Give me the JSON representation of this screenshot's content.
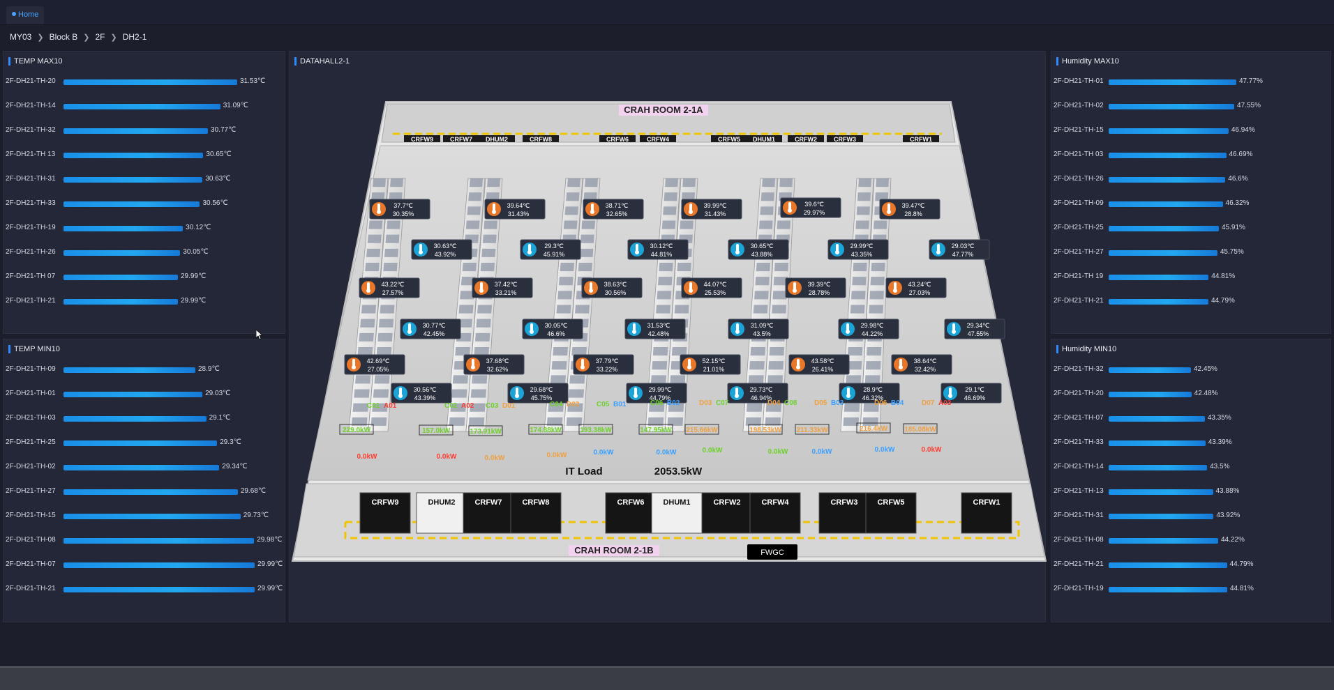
{
  "tab": {
    "label": "Home"
  },
  "breadcrumb": [
    "MY03",
    "Block B",
    "2F",
    "DH2-1"
  ],
  "colors": {
    "accent": "#2f8cff",
    "bar": "#22a7f0",
    "background": "#1c1f2b",
    "panel": "#232737"
  },
  "panels": {
    "temp_max": {
      "title": "TEMP MAX10",
      "rows": [
        {
          "label": "2F-DH21-TH-20",
          "value": "31.53℃",
          "num": 31.53
        },
        {
          "label": "2F-DH21-TH-14",
          "value": "31.09℃",
          "num": 31.09
        },
        {
          "label": "2F-DH21-TH-32",
          "value": "30.77℃",
          "num": 30.77
        },
        {
          "label": "2F-DH21-TH 13",
          "value": "30.65℃",
          "num": 30.65
        },
        {
          "label": "2F-DH21-TH-31",
          "value": "30.63℃",
          "num": 30.63
        },
        {
          "label": "2F-DH21-TH-33",
          "value": "30.56℃",
          "num": 30.56
        },
        {
          "label": "2F-DH21-TH-19",
          "value": "30.12℃",
          "num": 30.12
        },
        {
          "label": "2F-DH21-TH-26",
          "value": "30.05℃",
          "num": 30.05
        },
        {
          "label": "2F-DH21-TH 07",
          "value": "29.99℃",
          "num": 29.99
        },
        {
          "label": "2F-DH21-TH-21",
          "value": "29.99℃",
          "num": 29.99
        }
      ]
    },
    "temp_min": {
      "title": "TEMP MIN10",
      "rows": [
        {
          "label": "2F-DH21-TH-09",
          "value": "28.9℃",
          "num": 28.9
        },
        {
          "label": "2F-DH21-TH-01",
          "value": "29.03℃",
          "num": 29.03
        },
        {
          "label": "2F-DH21-TH-03",
          "value": "29.1℃",
          "num": 29.1
        },
        {
          "label": "2F-DH21-TH-25",
          "value": "29.3℃",
          "num": 29.3
        },
        {
          "label": "2F-DH21-TH-02",
          "value": "29.34℃",
          "num": 29.34
        },
        {
          "label": "2F-DH21-TH-27",
          "value": "29.68℃",
          "num": 29.68
        },
        {
          "label": "2F-DH21-TH-15",
          "value": "29.73℃",
          "num": 29.73
        },
        {
          "label": "2F-DH21-TH-08",
          "value": "29.98℃",
          "num": 29.98
        },
        {
          "label": "2F-DH21-TH-07",
          "value": "29.99℃",
          "num": 29.99
        },
        {
          "label": "2F-DH21-TH-21",
          "value": "29.99℃",
          "num": 29.99
        }
      ]
    },
    "hum_max": {
      "title": "Humidity MAX10",
      "rows": [
        {
          "label": "2F-DH21-TH-01",
          "value": "47.77%",
          "num": 47.77
        },
        {
          "label": "2F-DH21-TH-02",
          "value": "47.55%",
          "num": 47.55
        },
        {
          "label": "2F-DH21-TH-15",
          "value": "46.94%",
          "num": 46.94
        },
        {
          "label": "2F-DH21-TH 03",
          "value": "46.69%",
          "num": 46.69
        },
        {
          "label": "2F-DH21-TH-26",
          "value": "46.6%",
          "num": 46.6
        },
        {
          "label": "2F-DH21-TH-09",
          "value": "46.32%",
          "num": 46.32
        },
        {
          "label": "2F-DH21-TH-25",
          "value": "45.91%",
          "num": 45.91
        },
        {
          "label": "2F-DH21-TH-27",
          "value": "45.75%",
          "num": 45.75
        },
        {
          "label": "2F-DH21-TH 19",
          "value": "44.81%",
          "num": 44.81
        },
        {
          "label": "2F-DH21-TH-21",
          "value": "44.79%",
          "num": 44.79
        }
      ]
    },
    "hum_min": {
      "title": "Humidity MIN10",
      "rows": [
        {
          "label": "2F-DH21-TH-32",
          "value": "42.45%",
          "num": 42.45
        },
        {
          "label": "2F-DH21-TH-20",
          "value": "42.48%",
          "num": 42.48
        },
        {
          "label": "2F-DH21-TH-07",
          "value": "43.35%",
          "num": 43.35
        },
        {
          "label": "2F-DH21-TH-33",
          "value": "43.39%",
          "num": 43.39
        },
        {
          "label": "2F-DH21-TH-14",
          "value": "43.5%",
          "num": 43.5
        },
        {
          "label": "2F-DH21-TH-13",
          "value": "43.88%",
          "num": 43.88
        },
        {
          "label": "2F-DH21-TH-31",
          "value": "43.92%",
          "num": 43.92
        },
        {
          "label": "2F-DH21-TH-08",
          "value": "44.22%",
          "num": 44.22
        },
        {
          "label": "2F-DH21-TH-21",
          "value": "44.79%",
          "num": 44.79
        },
        {
          "label": "2F-DH21-TH-19",
          "value": "44.81%",
          "num": 44.81
        }
      ]
    }
  },
  "hall": {
    "title": "DATAHALL2-1",
    "crah_top": "CRAH ROOM 2-1A",
    "crah_bottom": "CRAH ROOM 2-1B",
    "fwgc": "FWGC",
    "it_load_label": "IT Load",
    "it_load_value": "2053.5kW",
    "top_units": [
      "CRFW9",
      "CRFW7",
      "DHUM2",
      "CRFW8",
      "CRFW6",
      "CRFW4",
      "CRFW5",
      "DHUM1",
      "CRFW2",
      "CRFW3",
      "CRFW1"
    ],
    "bottom_units": [
      "CRFW9",
      "DHUM2",
      "CRFW7",
      "CRFW8",
      "CRFW6",
      "DHUM1",
      "CRFW2",
      "CRFW4",
      "CRFW3",
      "CRFW5",
      "CRFW1"
    ],
    "sensors": [
      {
        "kind": "temp",
        "t": "37.7℃",
        "h": "30.35%"
      },
      {
        "kind": "temp",
        "t": "39.64℃",
        "h": "31.43%"
      },
      {
        "kind": "temp",
        "t": "38.71℃",
        "h": "32.65%"
      },
      {
        "kind": "temp",
        "t": "39.99℃",
        "h": "31.43%"
      },
      {
        "kind": "temp",
        "t": "39.6℃",
        "h": "29.97%"
      },
      {
        "kind": "temp",
        "t": "39.47℃",
        "h": "28.8%"
      },
      {
        "kind": "hum",
        "t": "30.63℃",
        "h": "43.92%"
      },
      {
        "kind": "hum",
        "t": "29.3℃",
        "h": "45.91%"
      },
      {
        "kind": "hum",
        "t": "30.12℃",
        "h": "44.81%"
      },
      {
        "kind": "hum",
        "t": "30.65℃",
        "h": "43.88%"
      },
      {
        "kind": "hum",
        "t": "29.99℃",
        "h": "43.35%"
      },
      {
        "kind": "hum",
        "t": "29.03℃",
        "h": "47.77%"
      },
      {
        "kind": "temp",
        "t": "43.22℃",
        "h": "27.57%"
      },
      {
        "kind": "temp",
        "t": "37.42℃",
        "h": "33.21%"
      },
      {
        "kind": "temp",
        "t": "38.63℃",
        "h": "30.56%"
      },
      {
        "kind": "temp",
        "t": "44.07℃",
        "h": "25.53%"
      },
      {
        "kind": "temp",
        "t": "39.39℃",
        "h": "28.78%"
      },
      {
        "kind": "temp",
        "t": "43.24℃",
        "h": "27.03%"
      },
      {
        "kind": "hum",
        "t": "30.77℃",
        "h": "42.45%"
      },
      {
        "kind": "hum",
        "t": "30.05℃",
        "h": "46.6%"
      },
      {
        "kind": "hum",
        "t": "31.53℃",
        "h": "42.48%"
      },
      {
        "kind": "hum",
        "t": "31.09℃",
        "h": "43.5%"
      },
      {
        "kind": "hum",
        "t": "29.98℃",
        "h": "44.22%"
      },
      {
        "kind": "hum",
        "t": "29.34℃",
        "h": "47.55%"
      },
      {
        "kind": "temp",
        "t": "42.69℃",
        "h": "27.05%"
      },
      {
        "kind": "temp",
        "t": "37.68℃",
        "h": "32.62%"
      },
      {
        "kind": "temp",
        "t": "37.79℃",
        "h": "33.22%"
      },
      {
        "kind": "temp",
        "t": "52.15℃",
        "h": "21.01%"
      },
      {
        "kind": "temp",
        "t": "43.58℃",
        "h": "26.41%"
      },
      {
        "kind": "temp",
        "t": "38.64℃",
        "h": "32.42%"
      },
      {
        "kind": "hum",
        "t": "30.56℃",
        "h": "43.39%"
      },
      {
        "kind": "hum",
        "t": "29.68℃",
        "h": "45.75%"
      },
      {
        "kind": "hum",
        "t": "29.99℃",
        "h": "44.79%"
      },
      {
        "kind": "hum",
        "t": "29.73℃",
        "h": "46.94%"
      },
      {
        "kind": "hum",
        "t": "28.9℃",
        "h": "46.32%"
      },
      {
        "kind": "hum",
        "t": "29.1℃",
        "h": "46.69%"
      }
    ],
    "row_labels": [
      {
        "a": "C01",
        "b": "A01",
        "ca": "#6ed22a",
        "cb": "#ff3b30"
      },
      {
        "a": "C02",
        "b": "A02",
        "ca": "#6ed22a",
        "cb": "#ff3b30"
      },
      {
        "a": "C03",
        "b": "D01",
        "ca": "#6ed22a",
        "cb": "#f0a040"
      },
      {
        "a": "C04",
        "b": "D02",
        "ca": "#6ed22a",
        "cb": "#f0a040"
      },
      {
        "a": "C05",
        "b": "B01",
        "ca": "#6ed22a",
        "cb": "#3aa0ff"
      },
      {
        "a": "C06",
        "b": "B02",
        "ca": "#6ed22a",
        "cb": "#3aa0ff"
      },
      {
        "a": "D03",
        "b": "C07",
        "ca": "#f0a040",
        "cb": "#6ed22a"
      },
      {
        "a": "D04",
        "b": "C08",
        "ca": "#f0a040",
        "cb": "#6ed22a"
      },
      {
        "a": "D05",
        "b": "B03",
        "ca": "#f0a040",
        "cb": "#3aa0ff"
      },
      {
        "a": "D06",
        "b": "B04",
        "ca": "#f0a040",
        "cb": "#3aa0ff"
      },
      {
        "a": "D07",
        "b": "A03",
        "ca": "#f0a040",
        "cb": "#ff3b30"
      }
    ],
    "boxed_loads": [
      {
        "text": "229.0kW",
        "color": "#6ed22a"
      },
      {
        "text": "157.0kW",
        "color": "#6ed22a"
      },
      {
        "text": "173.91kW",
        "color": "#6ed22a"
      },
      {
        "text": "174.88kW",
        "color": "#6ed22a"
      },
      {
        "text": "193.38kW",
        "color": "#6ed22a"
      },
      {
        "text": "147.95kW",
        "color": "#6ed22a"
      },
      {
        "text": "215.66kW",
        "color": "#f0a040"
      },
      {
        "text": "198.53kW",
        "color": "#f0a040"
      },
      {
        "text": "211.33kW",
        "color": "#f0a040"
      },
      {
        "text": "216.4kW",
        "color": "#f0a040"
      },
      {
        "text": "185.08kW",
        "color": "#f0a040"
      }
    ],
    "zero_loads": [
      {
        "text": "0.0kW",
        "color": "#ff3b30"
      },
      {
        "text": "0.0kW",
        "color": "#ff3b30"
      },
      {
        "text": "0.0kW",
        "color": "#f0a040"
      },
      {
        "text": "0.0kW",
        "color": "#f0a040"
      },
      {
        "text": "0.0kW",
        "color": "#3aa0ff"
      },
      {
        "text": "0.0kW",
        "color": "#3aa0ff"
      },
      {
        "text": "0.0kW",
        "color": "#6ed22a"
      },
      {
        "text": "0.0kW",
        "color": "#6ed22a"
      },
      {
        "text": "0.0kW",
        "color": "#3aa0ff"
      },
      {
        "text": "0.0kW",
        "color": "#3aa0ff"
      },
      {
        "text": "0.0kW",
        "color": "#ff3b30"
      }
    ]
  }
}
